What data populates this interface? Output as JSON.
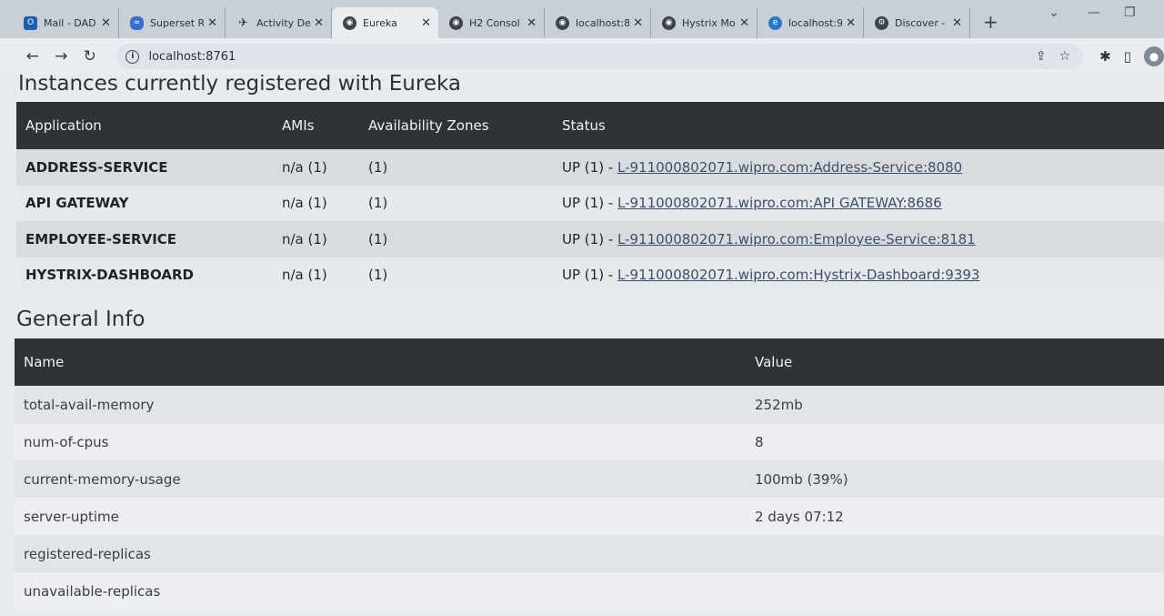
{
  "browser": {
    "tabs": [
      {
        "title": "Mail - DAD",
        "icon": "outlook-icon"
      },
      {
        "title": "Superset R",
        "icon": "superset-icon"
      },
      {
        "title": "Activity De",
        "icon": "activity-icon"
      },
      {
        "title": "Eureka",
        "icon": "globe-icon",
        "active": true
      },
      {
        "title": "H2 Consol",
        "icon": "globe-icon"
      },
      {
        "title": "localhost:8",
        "icon": "globe-icon"
      },
      {
        "title": "Hystrix Mo",
        "icon": "globe-icon"
      },
      {
        "title": "localhost:9",
        "icon": "edge-icon"
      },
      {
        "title": "Discover -",
        "icon": "gear-icon"
      }
    ],
    "url": "localhost:8761"
  },
  "registered": {
    "heading": "Instances currently registered with Eureka",
    "columns": [
      "Application",
      "AMIs",
      "Availability Zones",
      "Status"
    ],
    "rows": [
      {
        "app": "ADDRESS-SERVICE",
        "amis": "n/a (1)",
        "zones": "(1)",
        "status_prefix": "UP (1) - ",
        "status_link": "L-911000802071.wipro.com:Address-Service:8080"
      },
      {
        "app": "API GATEWAY",
        "amis": "n/a (1)",
        "zones": "(1)",
        "status_prefix": "UP (1) - ",
        "status_link": "L-911000802071.wipro.com:API GATEWAY:8686"
      },
      {
        "app": "EMPLOYEE-SERVICE",
        "amis": "n/a (1)",
        "zones": "(1)",
        "status_prefix": "UP (1) - ",
        "status_link": "L-911000802071.wipro.com:Employee-Service:8181"
      },
      {
        "app": "HYSTRIX-DASHBOARD",
        "amis": "n/a (1)",
        "zones": "(1)",
        "status_prefix": "UP (1) - ",
        "status_link": "L-911000802071.wipro.com:Hystrix-Dashboard:9393"
      }
    ]
  },
  "general": {
    "heading": "General Info",
    "columns": [
      "Name",
      "Value"
    ],
    "rows": [
      {
        "name": "total-avail-memory",
        "value": "252mb"
      },
      {
        "name": "num-of-cpus",
        "value": "8"
      },
      {
        "name": "current-memory-usage",
        "value": "100mb (39%)"
      },
      {
        "name": "server-uptime",
        "value": "2 days 07:12"
      },
      {
        "name": "registered-replicas",
        "value": ""
      },
      {
        "name": "unavailable-replicas",
        "value": ""
      }
    ]
  }
}
